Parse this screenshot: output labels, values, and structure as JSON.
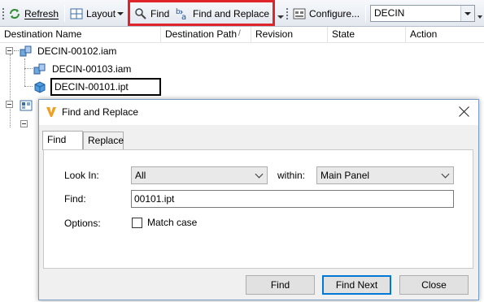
{
  "toolbar": {
    "refresh_label": "Refresh",
    "layout_label": "Layout",
    "find_label": "Find",
    "find_replace_label": "Find and Replace",
    "configure_label": "Configure...",
    "project_combo_value": "DECIN",
    "highlight_color": "#e0242c"
  },
  "grid": {
    "columns": [
      "Destination Name",
      "Destination Path",
      "Revision",
      "State",
      "Action"
    ],
    "sort_indicator": "/",
    "rows": [
      {
        "name": "DECIN-00102.iam",
        "icon": "assembly-icon"
      },
      {
        "name": "DECIN-00103.iam",
        "icon": "assembly-icon"
      },
      {
        "name": "DECIN-00101.ipt",
        "icon": "part-icon"
      }
    ]
  },
  "dialog": {
    "title": "Find and Replace",
    "app_icon": "inventor-v-icon",
    "tabs": [
      "Find",
      "Replace"
    ],
    "active_tab": "Find",
    "look_in_label": "Look In:",
    "look_in_value": "All",
    "within_label": "within:",
    "within_value": "Main Panel",
    "find_label": "Find:",
    "find_value": "00101.ipt",
    "options_label": "Options:",
    "match_case_label": "Match case",
    "match_case_checked": false,
    "buttons": {
      "find": "Find",
      "find_next": "Find Next",
      "close": "Close"
    },
    "accent_color": "#0078d7"
  }
}
